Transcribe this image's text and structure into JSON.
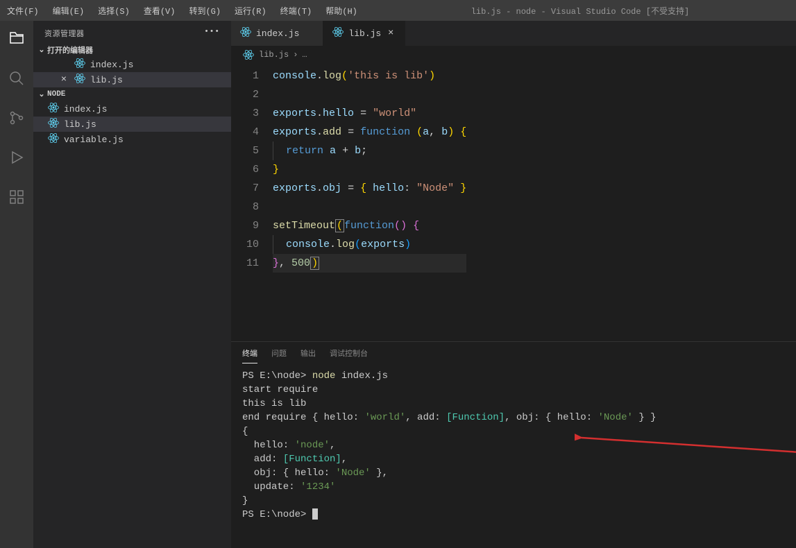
{
  "menu": [
    "文件(F)",
    "编辑(E)",
    "选择(S)",
    "查看(V)",
    "转到(G)",
    "运行(R)",
    "终端(T)",
    "帮助(H)"
  ],
  "title": "lib.js - node - Visual Studio Code [不受支持]",
  "sidebar": {
    "title": "资源管理器",
    "openEditors": "打开的编辑器",
    "items": [
      {
        "icon": "react",
        "name": "index.js",
        "active": false,
        "close": false
      },
      {
        "icon": "react",
        "name": "lib.js",
        "active": true,
        "close": true
      }
    ],
    "projectName": "NODE",
    "files": [
      {
        "icon": "react",
        "name": "index.js"
      },
      {
        "icon": "react",
        "name": "lib.js",
        "active": true
      },
      {
        "icon": "react",
        "name": "variable.js"
      }
    ]
  },
  "tabs": [
    {
      "name": "index.js",
      "active": false
    },
    {
      "name": "lib.js",
      "active": true
    }
  ],
  "breadcrumb": {
    "file": "lib.js"
  },
  "code": [
    {
      "n": 1,
      "html": "<span class='tk-obj'>console</span><span class='tk-p'>.</span><span class='tk-fn'>log</span><span class='tk-br1'>(</span><span class='tk-str'>'this is lib'</span><span class='tk-br1'>)</span>"
    },
    {
      "n": 2,
      "html": ""
    },
    {
      "n": 3,
      "html": "<span class='tk-obj'>exports</span><span class='tk-p'>.</span><span class='tk-obj'>hello</span> <span class='tk-p'>=</span> <span class='tk-str'>\"world\"</span>"
    },
    {
      "n": 4,
      "html": "<span class='tk-obj'>exports</span><span class='tk-p'>.</span><span class='tk-fn'>add</span> <span class='tk-p'>=</span> <span class='tk-kw'>function</span> <span class='tk-br1'>(</span><span class='tk-obj'>a</span><span class='tk-p'>,</span> <span class='tk-obj'>b</span><span class='tk-br1'>)</span> <span class='tk-br1'>{</span>"
    },
    {
      "n": 5,
      "html": "<span class='indent-guide'></span><span class='tk-kw'>return</span> <span class='tk-obj'>a</span> <span class='tk-p'>+</span> <span class='tk-obj'>b</span><span class='tk-p'>;</span>"
    },
    {
      "n": 6,
      "html": "<span class='tk-br1'>}</span>"
    },
    {
      "n": 7,
      "html": "<span class='tk-obj'>exports</span><span class='tk-p'>.</span><span class='tk-obj'>obj</span> <span class='tk-p'>=</span> <span class='tk-br1'>{</span> <span class='tk-obj'>hello</span><span class='tk-p'>:</span> <span class='tk-str'>\"Node\"</span> <span class='tk-br1'>}</span>"
    },
    {
      "n": 8,
      "html": ""
    },
    {
      "n": 9,
      "html": "<span class='tk-fn'>setTimeout</span><span class='tk-br1 bracket-hl'>(</span><span class='tk-kw'>function</span><span class='tk-br2'>(</span><span class='tk-br2'>)</span> <span class='tk-br2'>{</span>"
    },
    {
      "n": 10,
      "html": "<span class='indent-guide'></span><span class='tk-obj'>console</span><span class='tk-p'>.</span><span class='tk-fn'>log</span><span class='tk-br3'>(</span><span class='tk-obj'>exports</span><span class='tk-br3'>)</span>"
    },
    {
      "n": 11,
      "html": "<span class='tk-br2'>}</span><span class='tk-p'>,</span> <span class='tk-num'>500</span><span class='tk-br1 bracket-hl'>)</span>",
      "cur": true
    }
  ],
  "panelTabs": [
    "终端",
    "问题",
    "输出",
    "调试控制台"
  ],
  "activePanelTab": 0,
  "terminal": {
    "lines": [
      {
        "html": "PS E:\\node> <span class='term-yellow'>node</span> index.js"
      },
      {
        "html": "start require"
      },
      {
        "html": "this is lib"
      },
      {
        "html": "end require { hello: <span class='term-green'>'world'</span>, add: <span class='term-cyan'>[Function]</span>, obj: { hello: <span class='term-green'>'Node'</span> } }"
      },
      {
        "html": "{"
      },
      {
        "html": "&nbsp;&nbsp;hello: <span class='term-green'>'node'</span>,"
      },
      {
        "html": "&nbsp;&nbsp;add: <span class='term-cyan'>[Function]</span>,"
      },
      {
        "html": "&nbsp;&nbsp;obj: { hello: <span class='term-green'>'Node'</span> },"
      },
      {
        "html": "&nbsp;&nbsp;update: <span class='term-green'>'1234'</span>"
      },
      {
        "html": "}"
      },
      {
        "html": "PS E:\\node> <span class='cursor-block'></span>"
      }
    ]
  }
}
